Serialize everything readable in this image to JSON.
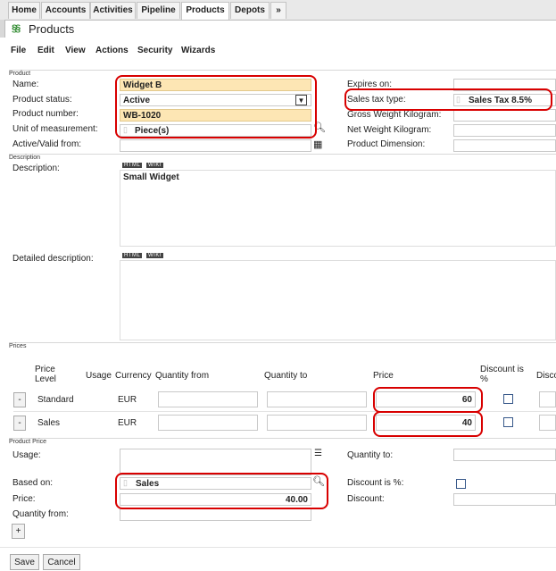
{
  "tabs": [
    "Home",
    "Accounts",
    "Activities",
    "Pipeline",
    "Products",
    "Depots",
    "»"
  ],
  "page_title": "Products",
  "menu": [
    "File",
    "Edit",
    "View",
    "Actions",
    "Security",
    "Wizards"
  ],
  "product": {
    "section": "Product",
    "name_label": "Name:",
    "name_value": "Widget B",
    "status_label": "Product status:",
    "status_value": "Active",
    "number_label": "Product number:",
    "number_value": "WB-1020",
    "uom_label": "Unit of measurement:",
    "uom_value": "Piece(s)",
    "active_label": "Active/Valid from:",
    "expires_label": "Expires on:",
    "tax_label": "Sales tax type:",
    "tax_value": "Sales Tax 8.5%",
    "gross_label": "Gross Weight Kilogram:",
    "net_label": "Net Weight Kilogram:",
    "dimension_label": "Product Dimension:"
  },
  "description": {
    "section": "Description",
    "desc_label": "Description:",
    "desc_value": "Small Widget",
    "detail_label": "Detailed description:",
    "html_tag": "HTML",
    "wiki_tag": "WIKI"
  },
  "prices": {
    "section": "Prices",
    "headers": {
      "level": "Price\nLevel",
      "usage": "Usage",
      "currency": "Currency",
      "qty_from": "Quantity from",
      "qty_to": "Quantity to",
      "price": "Price",
      "discount": "Discount is\n%",
      "discount2": "Disco"
    },
    "rows": [
      {
        "button": "-",
        "level": "Standard",
        "currency": "EUR",
        "price": "60"
      },
      {
        "button": "-",
        "level": "Sales",
        "currency": "EUR",
        "price": "40"
      }
    ]
  },
  "product_price": {
    "section": "Product Price",
    "usage_label": "Usage:",
    "qty_to_label": "Quantity to:",
    "based_label": "Based on:",
    "based_value": "Sales",
    "discount_pct_label": "Discount is %:",
    "price_label": "Price:",
    "price_value": "40.00",
    "discount_label": "Discount:",
    "qty_from_label": "Quantity from:",
    "add_button": "+"
  },
  "buttons": {
    "save": "Save",
    "cancel": "Cancel"
  },
  "colors": {
    "highlight": "#d80000",
    "required_field": "#fde6b4"
  }
}
